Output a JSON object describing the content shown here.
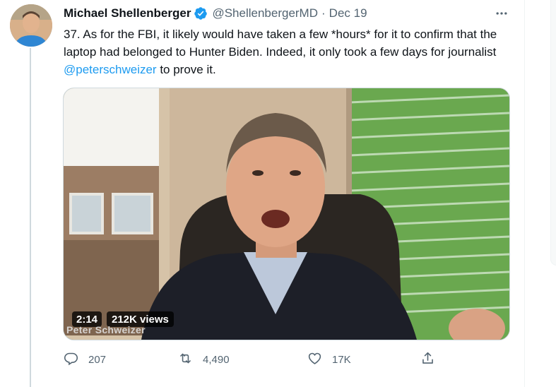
{
  "tweet": {
    "author_name": "Michael Shellenberger",
    "handle": "@ShellenbergerMD",
    "separator": "·",
    "date": "Dec 19",
    "text_before": "37. As for the FBI, it likely would have taken a few *hours* for it to confirm that the laptop had belonged to Hunter Biden. Indeed, it only took a few days for journalist ",
    "mention": "@peterschweizer",
    "text_after": " to prove it.",
    "verified": true
  },
  "media": {
    "duration": "2:14",
    "views": "212K views",
    "caption": "Peter Schweizer"
  },
  "actions": {
    "reply_count": "207",
    "retweet_count": "4,490",
    "like_count": "17K"
  },
  "icons": {
    "more": "more-icon",
    "verified": "verified-badge-icon",
    "reply": "reply-icon",
    "retweet": "retweet-icon",
    "like": "like-icon",
    "share": "share-icon"
  },
  "colors": {
    "text": "#0f1419",
    "secondary": "#536471",
    "accent": "#1d9bf0"
  }
}
